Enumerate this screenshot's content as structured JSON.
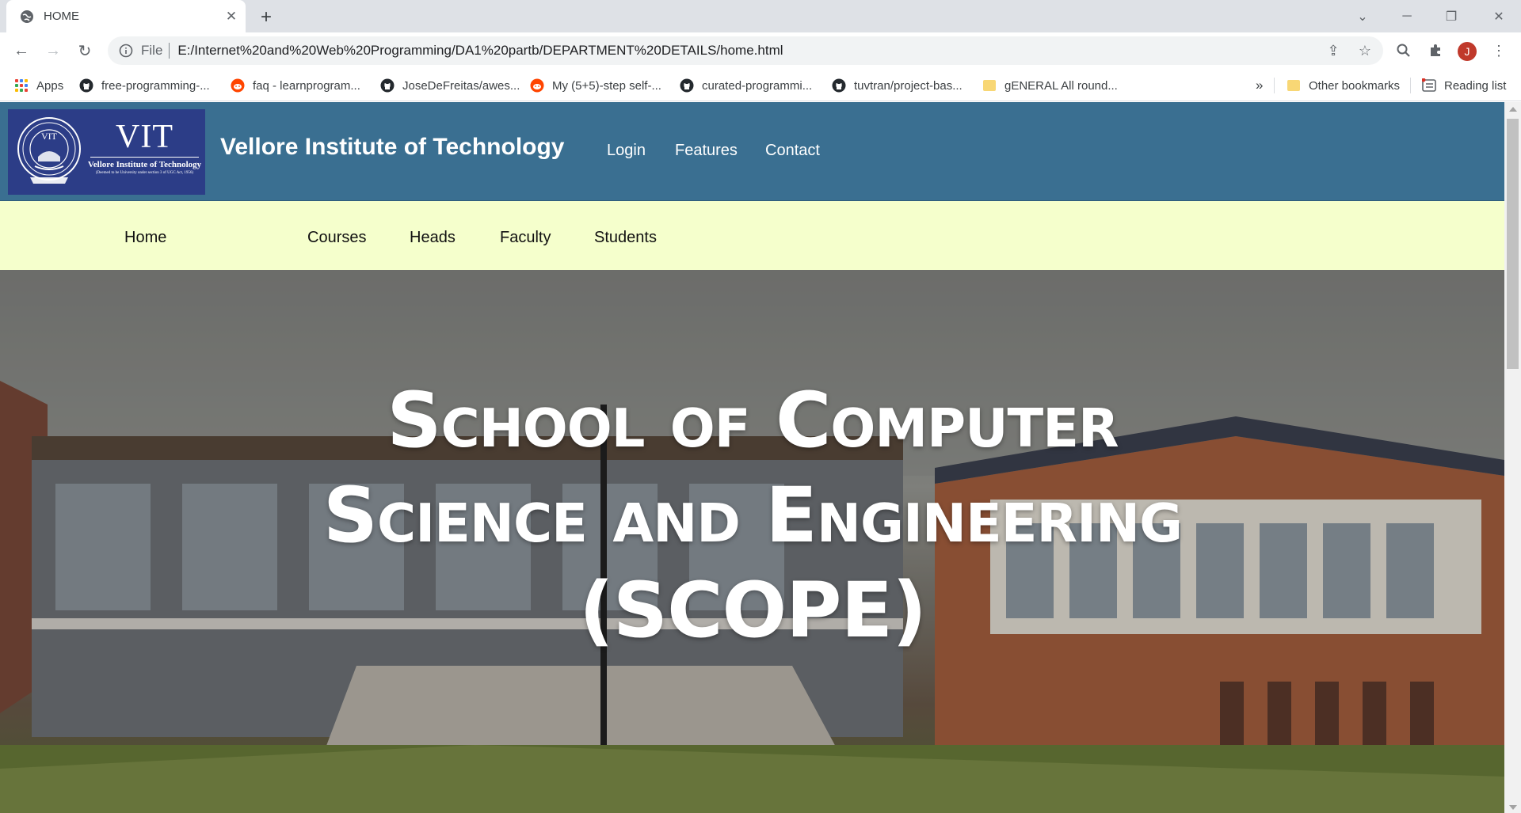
{
  "browser": {
    "tab_title": "HOME",
    "omnibox": {
      "file_label": "File",
      "url": "E:/Internet%20and%20Web%20Programming/DA1%20partb/DEPARTMENT%20DETAILS/home.html"
    },
    "profile_initial": "J",
    "bookmarks": [
      {
        "label": "Apps",
        "icon": "apps-icon"
      },
      {
        "label": "free-programming-...",
        "icon": "github-icon"
      },
      {
        "label": "faq - learnprogram...",
        "icon": "reddit-icon"
      },
      {
        "label": "JoseDeFreitas/awes...",
        "icon": "github-icon"
      },
      {
        "label": "My (5+5)-step self-...",
        "icon": "reddit-icon"
      },
      {
        "label": "curated-programmi...",
        "icon": "github-icon"
      },
      {
        "label": "tuvtran/project-bas...",
        "icon": "github-icon"
      },
      {
        "label": "gENERAL All round...",
        "icon": "folder-icon"
      }
    ],
    "overflow_label": "»",
    "other_bookmarks": "Other bookmarks",
    "reading_list": "Reading list"
  },
  "site": {
    "logo": {
      "vit": "VIT",
      "name": "Vellore Institute of Technology",
      "subtitle": "(Deemed to be University under section 3 of UGC Act, 1956)"
    },
    "title": "Vellore Institute of Technology",
    "top_nav": [
      "Login",
      "Features",
      "Contact"
    ],
    "sub_nav": [
      "Home",
      "Courses",
      "Heads",
      "Faculty",
      "Students"
    ],
    "hero": {
      "title": "School of Computer Science and Engineering (SCOPE)"
    },
    "colors": {
      "header": "#3a6f91",
      "subnav": "#f5ffcc",
      "logo_bg": "#2c3d87"
    }
  }
}
